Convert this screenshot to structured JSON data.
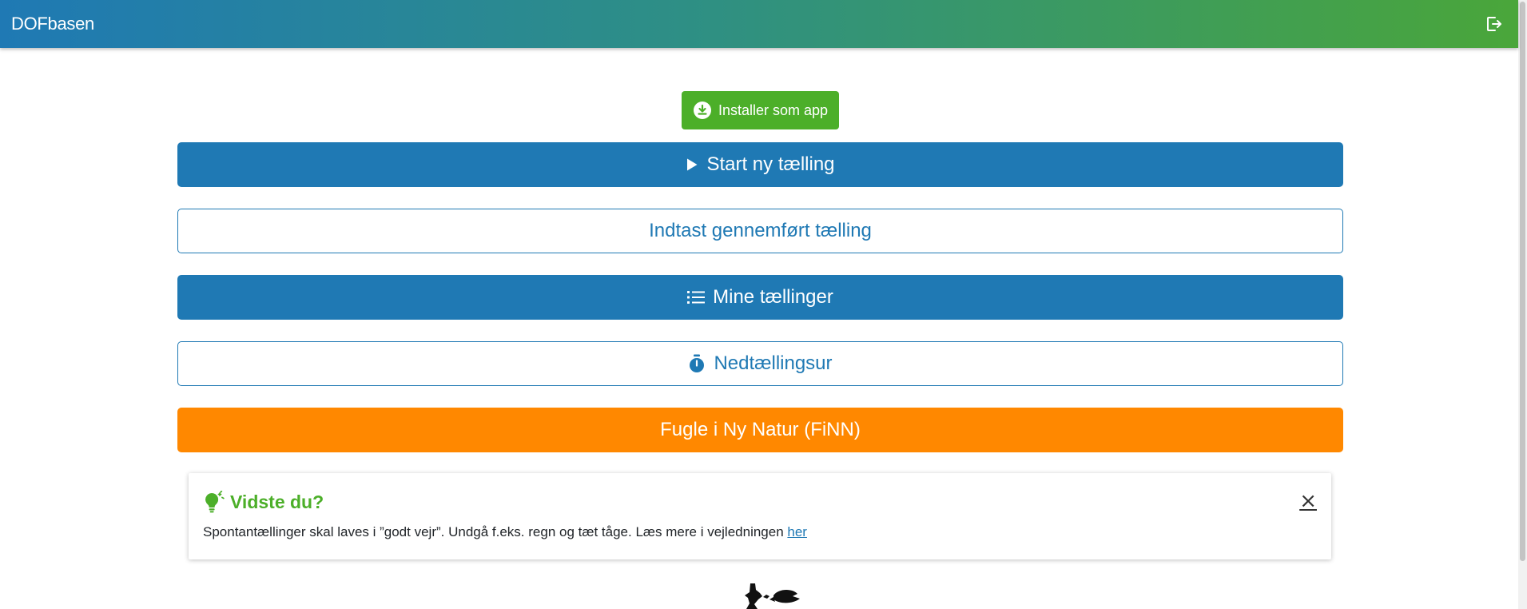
{
  "header": {
    "brand": "DOFbasen",
    "logout_icon": "logout-icon",
    "gradient": [
      "#1f79b4",
      "#4aa63a"
    ]
  },
  "install": {
    "label": "Installer som app",
    "icon": "download-circle-icon",
    "color": "#4caf29"
  },
  "buttons": {
    "start_new": {
      "label": "Start ny tælling",
      "icon": "play-icon"
    },
    "enter_completed": {
      "label": "Indtast gennemført tælling"
    },
    "my_counts": {
      "label": "Mine tællinger",
      "icon": "list-icon"
    },
    "countdown": {
      "label": "Nedtællingsur",
      "icon": "stopwatch-icon"
    },
    "finn": {
      "label": "Fugle i Ny Natur (FiNN)"
    }
  },
  "tip": {
    "title": "Vidste du?",
    "icon": "lightbulb-icon",
    "text": "Spontantællinger skal laves i ”godt vejr”. Undgå f.eks. regn og tæt tåge. Læs mere i vejledningen ",
    "link": "her",
    "close": "×"
  },
  "colors": {
    "primary": "#1f79b4",
    "success": "#4caf29",
    "orange": "#ff8800"
  }
}
